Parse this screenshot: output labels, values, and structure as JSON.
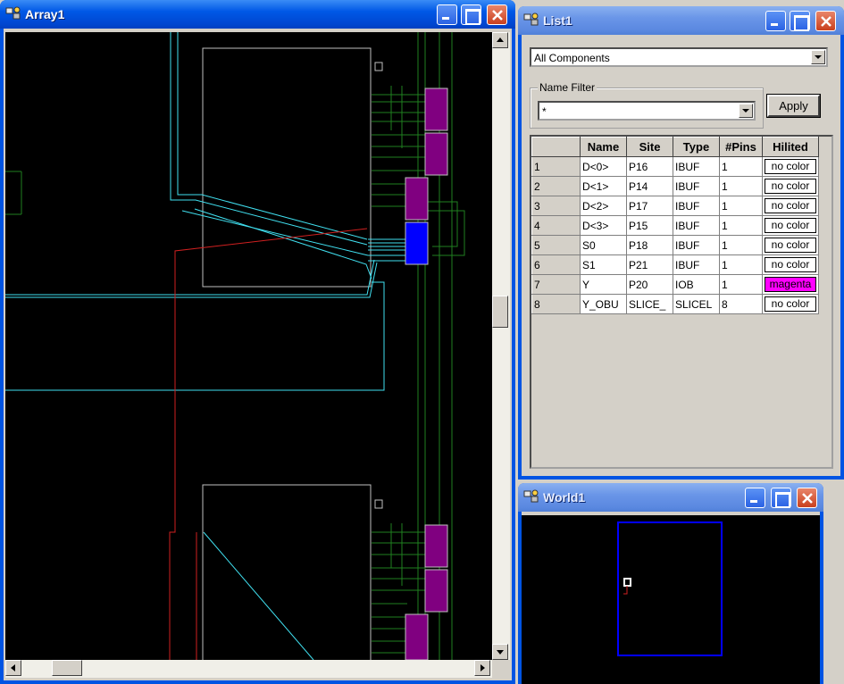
{
  "windows": {
    "array": {
      "title": "Array1"
    },
    "list": {
      "title": "List1",
      "filter_select": "All Components",
      "name_filter_label": "Name Filter",
      "name_filter_value": "*",
      "apply_label": "Apply",
      "columns": [
        "",
        "Name",
        "Site",
        "Type",
        "#Pins",
        "Hilited"
      ],
      "rows": [
        {
          "num": "1",
          "name": "D<0>",
          "site": "P16",
          "type": "IBUF",
          "pins": "1",
          "hilited": "no color",
          "color": "#ffffff"
        },
        {
          "num": "2",
          "name": "D<1>",
          "site": "P14",
          "type": "IBUF",
          "pins": "1",
          "hilited": "no color",
          "color": "#ffffff"
        },
        {
          "num": "3",
          "name": "D<2>",
          "site": "P17",
          "type": "IBUF",
          "pins": "1",
          "hilited": "no color",
          "color": "#ffffff"
        },
        {
          "num": "4",
          "name": "D<3>",
          "site": "P15",
          "type": "IBUF",
          "pins": "1",
          "hilited": "no color",
          "color": "#ffffff"
        },
        {
          "num": "5",
          "name": "S0",
          "site": "P18",
          "type": "IBUF",
          "pins": "1",
          "hilited": "no color",
          "color": "#ffffff"
        },
        {
          "num": "6",
          "name": "S1",
          "site": "P21",
          "type": "IBUF",
          "pins": "1",
          "hilited": "no color",
          "color": "#ffffff"
        },
        {
          "num": "7",
          "name": "Y",
          "site": "P20",
          "type": "IOB",
          "pins": "1",
          "hilited": "magenta",
          "color": "#ff00ff"
        },
        {
          "num": "8",
          "name": "Y_OBU",
          "site": "SLICE_",
          "type": "SLICEL",
          "pins": "8",
          "hilited": "no color",
          "color": "#ffffff"
        }
      ]
    },
    "world": {
      "title": "World1"
    }
  },
  "colors": {
    "titlebar": "#0054e3",
    "canvas": "#000000",
    "route_cyan": "#40e0f0",
    "route_green": "#208020",
    "route_red": "#d02020",
    "comp_purple": "#800080",
    "comp_blue": "#0000ff",
    "highlight_magenta": "#ff00ff"
  }
}
